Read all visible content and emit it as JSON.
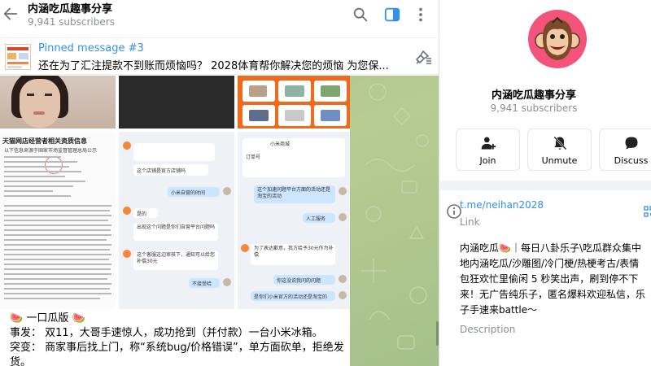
{
  "header": {
    "title": "内涵吃瓜趣事分享",
    "subscribers": "9,941 subscribers"
  },
  "pinned": {
    "label": "Pinned message #3",
    "text": "还在为了汇注提款不到账而烦恼吗？ 2028体育帮你解决您的烦恼 为您保..."
  },
  "message": {
    "caption_title": "一口瓜版",
    "melon_emoji": "🍉",
    "event_line": "事发：  双11，大哥手速惊人，成功抢到（并付款）一台小米冰箱。",
    "reversal_line": "突变：  商家事后找上门，称“系统bug/价格错误”，单方面砍单，拒绝发",
    "reversal_cont": "货。"
  },
  "media": {
    "doc_title": "天猫网店经营者相关资质信息",
    "doc_subtitle": "以下信息来源于国家市场监督管理总局公示",
    "chat1_bubbles": [
      "这个店铺是官方店铺吗",
      "小米自营的时间",
      "是的",
      "出现这个问题是你们自营平台问题吗",
      "这个客服这边审核下，通知可以给您补偿30元",
      "不接受哈"
    ],
    "chat2_bubbles": [
      "小米商城",
      "订单号",
      "这个加速问题平台方面的活动还是淘宝的活动",
      "人工服务",
      "为了表达歉意，我方给予30元作为补偿",
      "你这没说我问的问题",
      "是你们小米官方的活动还是淘宝的"
    ]
  },
  "info": {
    "title": "内涵吃瓜趣事分享",
    "subscribers": "9,941 subscribers",
    "actions": [
      {
        "label": "Join",
        "icon": "add-user-icon"
      },
      {
        "label": "Unmute",
        "icon": "bell-off-icon"
      },
      {
        "label": "Discuss",
        "icon": "chat-bubble-icon"
      }
    ],
    "link": "t.me/neihan2028",
    "link_label": "Link",
    "description_lines": [
      "内涵吃瓜🍉｜每日八卦乐子\\吃瓜群众集中",
      "地内涵吃瓜/沙雕图/冷门梗/热梗考古/表情",
      "包狂欢忙里偷闲 5 秒笑出声，刷到停不下",
      "来！无广告纯乐子，匿名爆料欢迎私信，乐",
      "子手速来battle～"
    ],
    "description_label": "Description"
  },
  "colors": {
    "accent": "#3390ec",
    "muted": "#8a8f96",
    "avatar": "#f4537b",
    "chat_bg": "#a9c192"
  }
}
